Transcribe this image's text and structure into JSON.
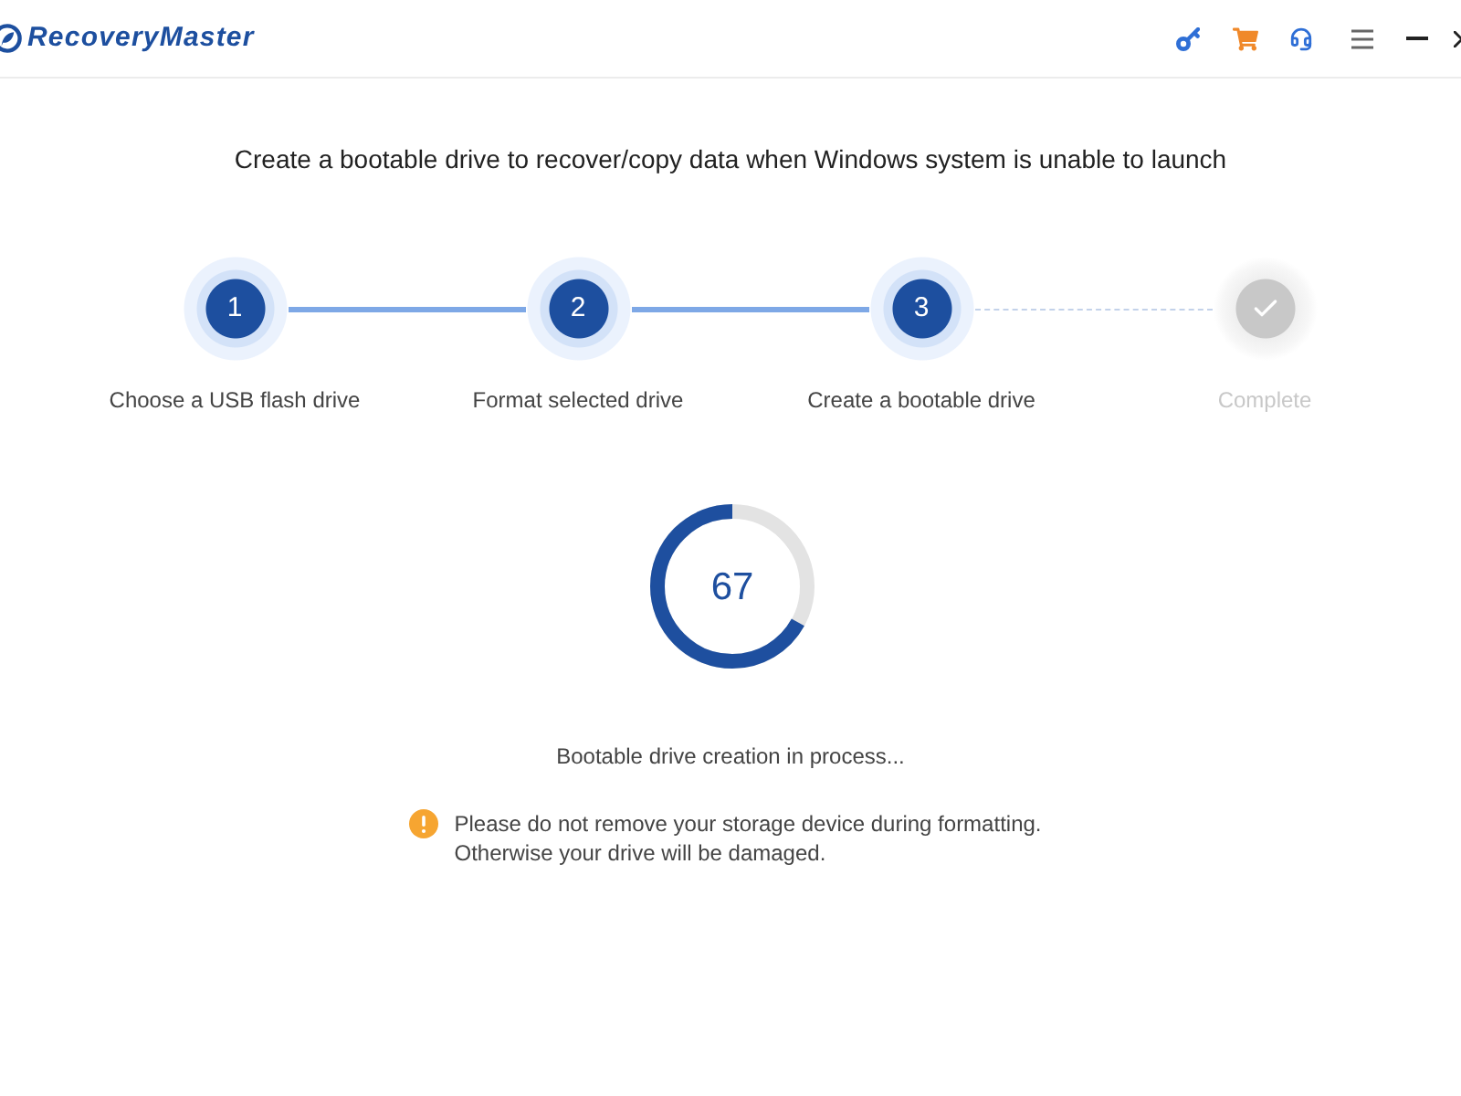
{
  "header": {
    "app_name": "RecoveryMaster"
  },
  "title": "Create a bootable drive to recover/copy data when Windows system is unable to launch",
  "steps": [
    {
      "number": "1",
      "label": "Choose a USB flash drive",
      "active": true
    },
    {
      "number": "2",
      "label": "Format selected drive",
      "active": true
    },
    {
      "number": "3",
      "label": "Create a bootable drive",
      "active": true
    },
    {
      "label": "Complete",
      "active": false
    }
  ],
  "progress": {
    "level": 0.67,
    "reading": "67",
    "status": "Bootable drive creation in process..."
  },
  "warning": {
    "lines": [
      "Please do not remove your storage device during formatting.",
      "Otherwise your drive will be damaged."
    ]
  }
}
